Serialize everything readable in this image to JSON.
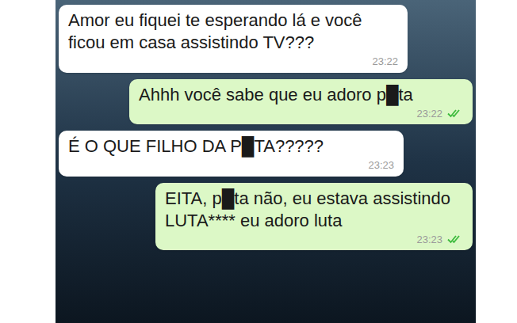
{
  "messages": [
    {
      "kind": "incoming",
      "text": "Amor eu fiquei te esperando lá e você ficou em casa assistindo TV???",
      "time": "23:22",
      "read": false
    },
    {
      "kind": "outgoing",
      "text": "Ahhh você sabe que eu adoro p█ta",
      "time": "23:22",
      "read": true
    },
    {
      "kind": "incoming",
      "text": "É O QUE FILHO DA P█TA?????",
      "time": "23:23",
      "read": false
    },
    {
      "kind": "outgoing",
      "text": "EITA, p█ta não, eu estava assistindo LUTA**** eu adoro luta",
      "time": "23:23",
      "read": true
    }
  ]
}
